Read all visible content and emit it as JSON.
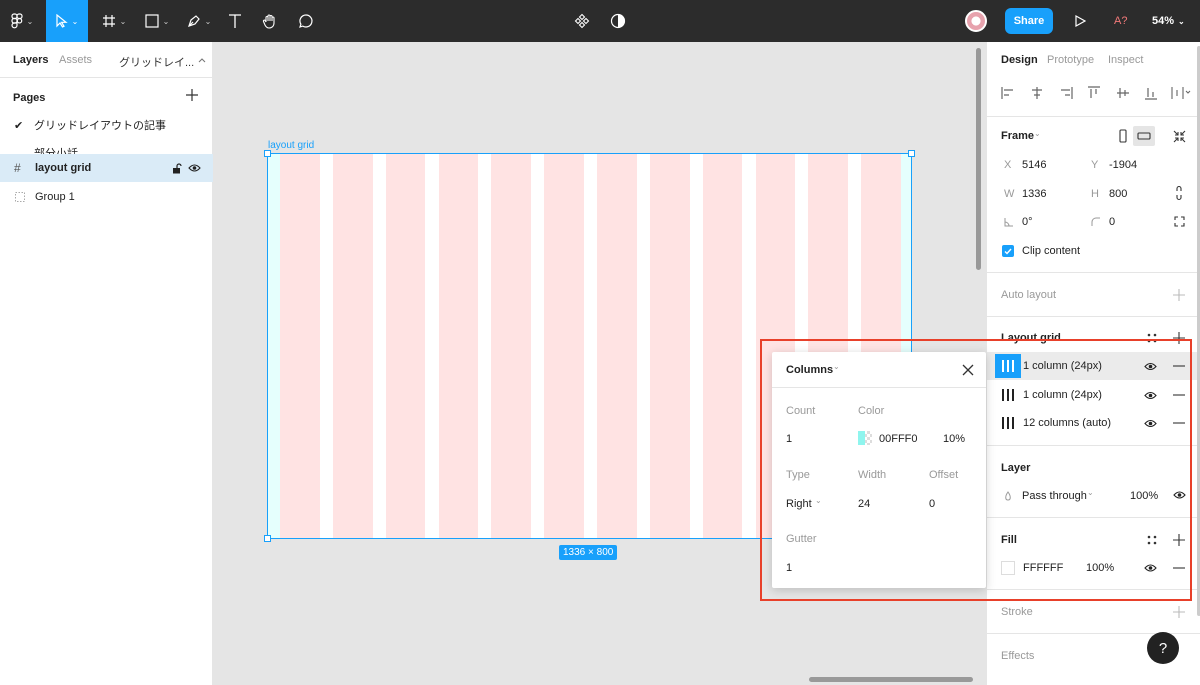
{
  "toolbar": {
    "share_label": "Share",
    "font_warning": "A?",
    "zoom": "54%"
  },
  "left_panel": {
    "tabs": {
      "layers": "Layers",
      "assets": "Assets",
      "page_name": "グリッドレイ..."
    },
    "pages_title": "Pages",
    "pages": [
      {
        "label": "グリッドレイアウトの記事",
        "current": true
      },
      {
        "label": "部分小話",
        "current": false
      }
    ],
    "layers": [
      {
        "name": "layout grid",
        "selected": true
      },
      {
        "name": "Group 1",
        "selected": false
      }
    ]
  },
  "canvas": {
    "frame_label": "layout grid",
    "size_badge": "1336 × 800",
    "grid": {
      "columns": 12,
      "column_color": "#FFE3E3",
      "side_tint": "#00FFF0"
    }
  },
  "popover": {
    "title": "Columns",
    "labels": {
      "count": "Count",
      "color": "Color",
      "type": "Type",
      "width": "Width",
      "offset": "Offset",
      "gutter": "Gutter"
    },
    "values": {
      "count": "1",
      "color_hex": "00FFF0",
      "opacity": "10%",
      "type": "Right",
      "width": "24",
      "offset": "0",
      "gutter": "1"
    }
  },
  "right_panel": {
    "tabs": {
      "design": "Design",
      "prototype": "Prototype",
      "inspect": "Inspect"
    },
    "frame": {
      "title": "Frame",
      "x_key": "X",
      "x": "5146",
      "y_key": "Y",
      "y": "-1904",
      "w_key": "W",
      "w": "1336",
      "h_key": "H",
      "h": "800",
      "rotation": "0°",
      "radius": "0",
      "clip_label": "Clip content",
      "clip_checked": true
    },
    "auto_layout": "Auto layout",
    "layout_grid": {
      "title": "Layout grid",
      "items": [
        {
          "label": "1 column (24px)",
          "active": true
        },
        {
          "label": "1 column (24px)",
          "active": false
        },
        {
          "label": "12 columns (auto)",
          "active": false
        }
      ]
    },
    "layer": {
      "title": "Layer",
      "blend": "Pass through",
      "opacity": "100%"
    },
    "fill": {
      "title": "Fill",
      "hex": "FFFFFF",
      "opacity": "100%"
    },
    "stroke": "Stroke",
    "effects": "Effects",
    "help": "?"
  },
  "colors": {
    "accent": "#18A0FB",
    "highlight_box": "#E8402A",
    "toolbar": "#2C2C2C"
  }
}
